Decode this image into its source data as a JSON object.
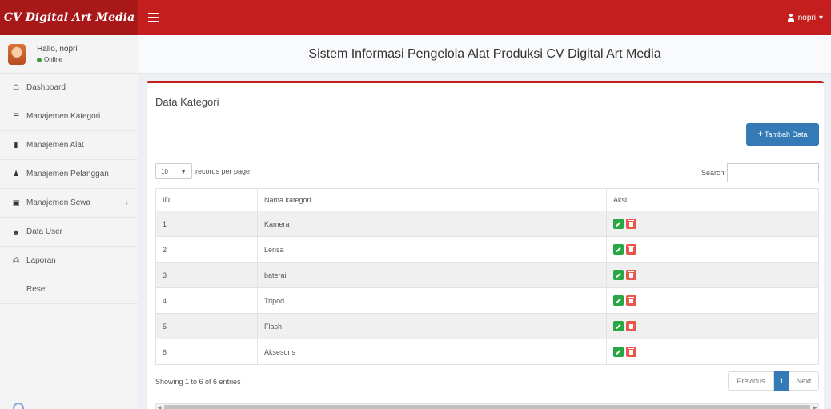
{
  "brand": "CV Digital Art Media",
  "header": {
    "user": "nopri"
  },
  "user_panel": {
    "greeting": "Hallo, nopri",
    "status": "Online"
  },
  "sidebar": {
    "items": [
      {
        "label": "Dashboard",
        "icon": "home-icon"
      },
      {
        "label": "Manajemen Kategori",
        "icon": "list-icon"
      },
      {
        "label": "Manajemen Alat",
        "icon": "book-icon"
      },
      {
        "label": "Manajemen Pelanggan",
        "icon": "users-icon"
      },
      {
        "label": "Manajemen Sewa",
        "icon": "cart-icon"
      },
      {
        "label": "Data User",
        "icon": "user-icon"
      },
      {
        "label": "Laporan",
        "icon": "print-icon"
      },
      {
        "label": "Reset",
        "icon": ""
      }
    ]
  },
  "page_title": "Sistem Informasi Pengelola Alat Produksi CV Digital Art Media",
  "box": {
    "title": "Data Kategori",
    "add_button": "Tambah Data",
    "length_value": "10",
    "length_suffix": "records per page",
    "search_label": "Search:",
    "columns": [
      "ID",
      "Nama kategori",
      "Aksi"
    ],
    "rows": [
      {
        "id": "1",
        "name": "Kamera"
      },
      {
        "id": "2",
        "name": "Lensa"
      },
      {
        "id": "3",
        "name": "baterai"
      },
      {
        "id": "4",
        "name": "Tripod"
      },
      {
        "id": "5",
        "name": "Flash"
      },
      {
        "id": "6",
        "name": "Aksesoris"
      }
    ],
    "info": "Showing 1 to 6 of 6 entries",
    "pagination": {
      "previous": "Previous",
      "page": "1",
      "next": "Next"
    }
  },
  "colors": {
    "header": "#c41e1e",
    "brand_bg": "#a81818",
    "primary": "#337ab7",
    "edit": "#28a745",
    "delete": "#e8574b"
  }
}
